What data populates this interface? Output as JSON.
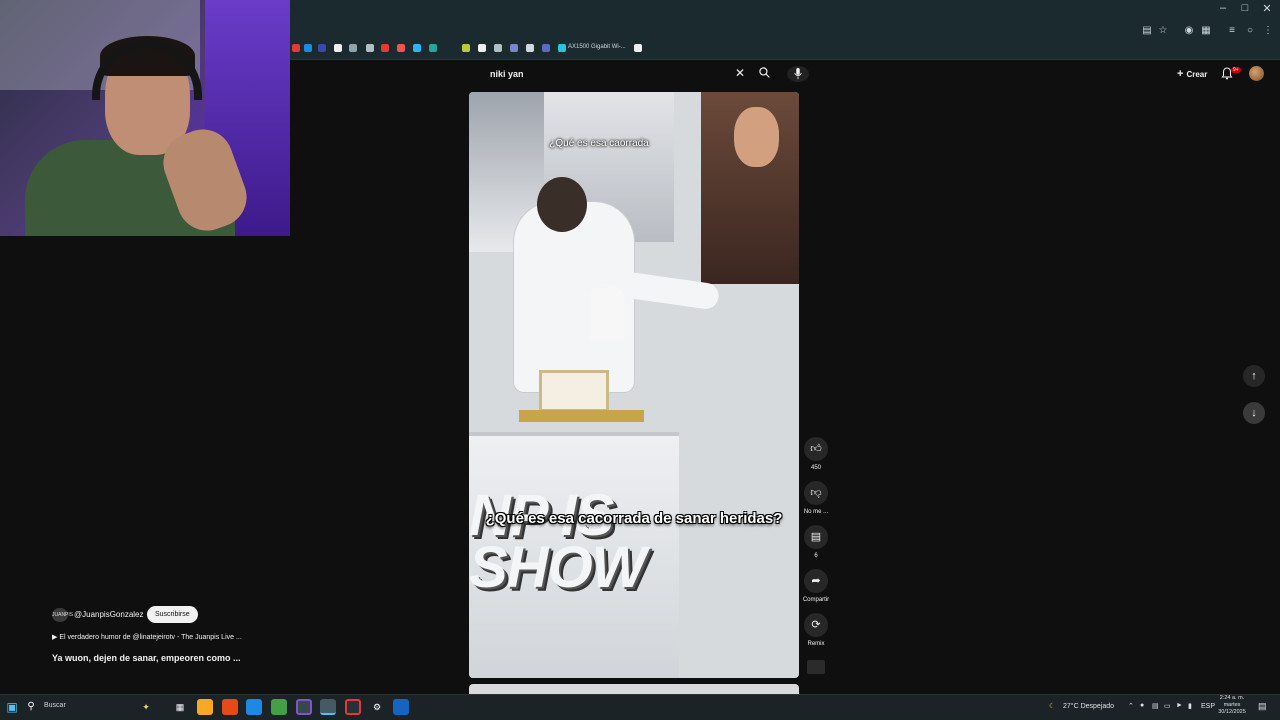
{
  "search": {
    "query": "niki yan"
  },
  "header": {
    "create_label": "Crear",
    "notifications_badge": "9+"
  },
  "bookmarks": {
    "visible_label": "AX1500 Gigabit Wi-..."
  },
  "video": {
    "caption_top": "¿Qué es esa caorrada",
    "caption_main": "¿Qué es esa cacorrada de sanar heridas?",
    "logo_text": "NP IS\nSHOW"
  },
  "actions": {
    "like_count": "450",
    "dislike_label": "No me ...",
    "comment_count": "6",
    "share_label": "Compartir",
    "remix_label": "Remix"
  },
  "channel": {
    "avatar_label": "JUANPIS",
    "handle": "@JuanpisGonzalez",
    "subscribe_label": "Suscribirse",
    "related_video": "El verdadero humor de @linatejeirotv - The Juanpis Live ...",
    "video_title": "Ya wuon, dejen de sanar, empeoren como ..."
  },
  "taskbar": {
    "search_label": "Buscar",
    "weather": "27°C  Despejado",
    "language": "ESP",
    "time": "2:24 a. m.",
    "day": "martes",
    "date": "30/12/2025"
  },
  "icons": {
    "search": "search-icon",
    "mic": "mic-icon",
    "close": "close-icon",
    "bell": "bell-icon",
    "like": "like-icon",
    "dislike": "dislike-icon",
    "comment": "comment-icon",
    "share": "share-icon",
    "remix": "remix-icon",
    "up": "arrow-up-icon",
    "down": "arrow-down-icon"
  },
  "colors": {
    "background": "#0f0f0f",
    "chrome": "#1b2a2e",
    "button": "#272727",
    "subscribe_bg": "#f1f1f1",
    "badge": "#cc0000"
  }
}
